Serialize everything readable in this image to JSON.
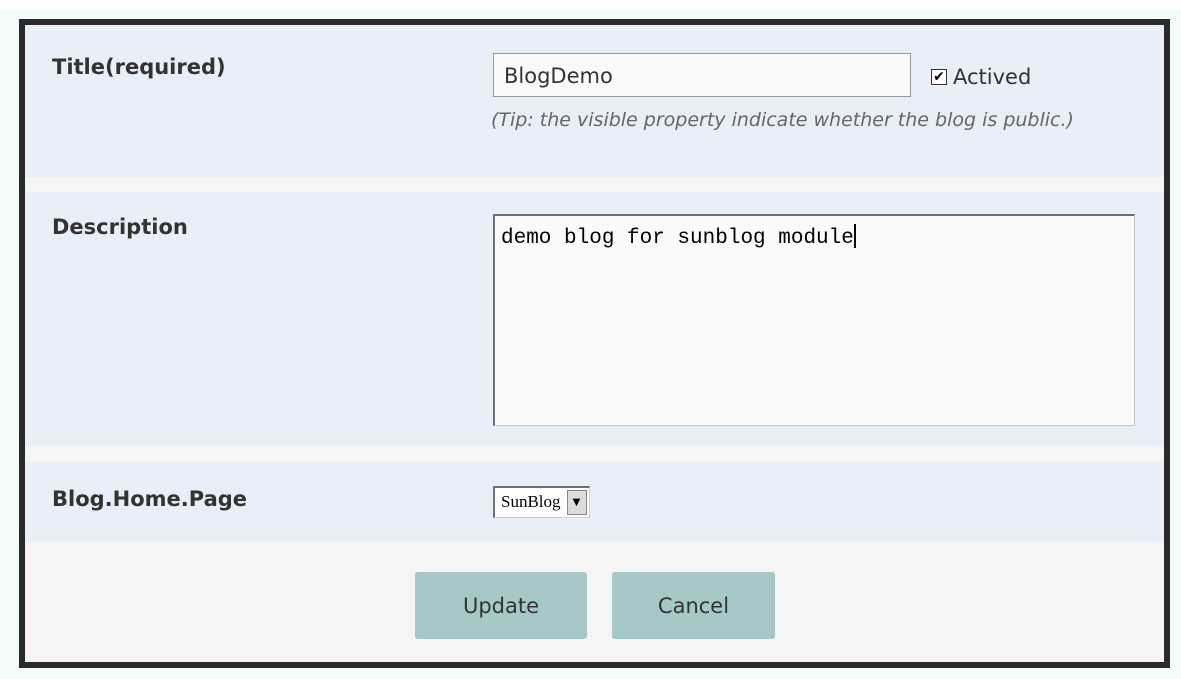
{
  "form": {
    "title_label": "Title(required)",
    "title_value": "BlogDemo",
    "actived_label": "Actived",
    "actived_checked": true,
    "tip": "(Tip: the visible property indicate whether the blog is public.)",
    "description_label": "Description",
    "description_value": "demo blog for sunblog module",
    "home_page_label": "Blog.Home.Page",
    "home_page_selected": "SunBlog",
    "check_glyph": "✔",
    "select_arrow_glyph": "▼"
  },
  "buttons": {
    "update": "Update",
    "cancel": "Cancel"
  },
  "colors": {
    "row_background": "#e8eff8",
    "frame_border": "#2a2a2a",
    "button_background": "#a6c8c8"
  }
}
